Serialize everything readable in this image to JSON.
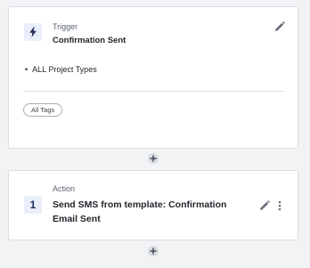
{
  "trigger": {
    "eyebrow": "Trigger",
    "title": "Confirmation Sent",
    "icon": "lightning-icon",
    "edit_icon": "pencil-icon",
    "conditions": {
      "project_types": [
        "ALL Project Types"
      ]
    },
    "tag_filter": "All Tags"
  },
  "add_buttons": [
    {
      "icon": "plus-icon"
    },
    {
      "icon": "plus-icon"
    }
  ],
  "action": {
    "eyebrow": "Action",
    "step_number": "1",
    "title": "Send SMS from template: Confirmation Email Sent",
    "edit_icon": "pencil-icon",
    "more_icon": "more-vertical-icon"
  },
  "colors": {
    "background": "#f2f3f5",
    "card": "#ffffff",
    "badge": "#e9eef8",
    "accent": "#1d2a57"
  }
}
